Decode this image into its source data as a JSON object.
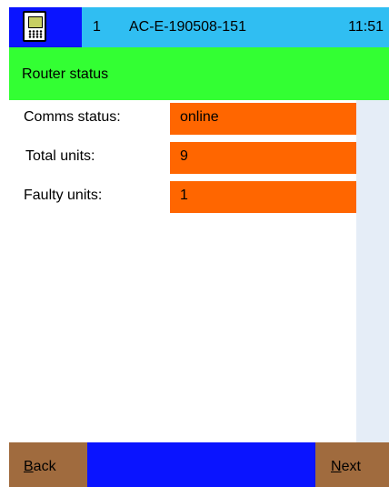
{
  "titlebar": {
    "icon": "handheld-device-icon",
    "number": "1",
    "device_id": "AC-E-190508-151",
    "time": "11:51"
  },
  "header": {
    "title": "Router status"
  },
  "status": {
    "comms_label": "Comms status:",
    "comms_value": "online",
    "total_label": "Total units:",
    "total_value": "9",
    "faulty_label": "Faulty units:",
    "faulty_value": "1"
  },
  "footer": {
    "back_mnemonic": "B",
    "back_rest": "ack",
    "next_mnemonic": "N",
    "next_rest": "ext"
  },
  "colors": {
    "titlebar_bg": "#30bef2",
    "icon_bg": "#0a14ff",
    "header_bg": "#33ff33",
    "value_bg": "#ff6600",
    "scroll_track": "#e5edf7",
    "footer_bg": "#0a14ff",
    "button_bg": "#a06b3e"
  }
}
